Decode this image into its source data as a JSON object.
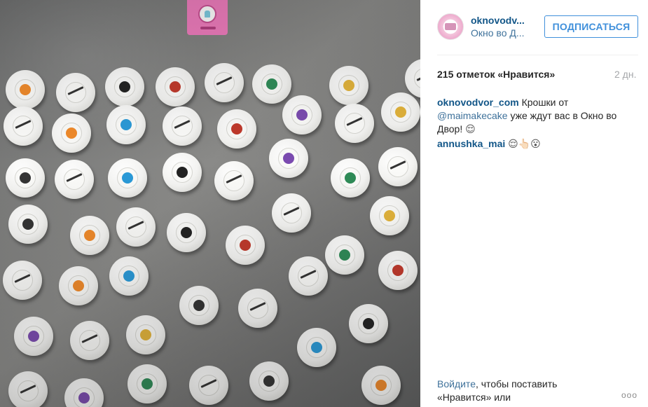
{
  "post": {
    "author_username": "oknovodv...",
    "location": "Окно во Д...",
    "follow_label": "ПОДПИСАТЬСЯ",
    "likes": "215 отметок «Нравится»",
    "time_ago": "2 дн.",
    "caption": {
      "username": "oknovodvor_com",
      "text_before": "Крошки от",
      "mention": "@maimakecake",
      "text_after": "уже ждут вас в Окно во Двор!",
      "emoji": "😌"
    },
    "comments": [
      {
        "username": "annushka_mai",
        "text": "😌👆🏻😮"
      }
    ],
    "login_prompt": {
      "link": "Войдите",
      "text": ", чтобы поставить «Нравится» или"
    },
    "more_label": "ooo"
  },
  "colors": {
    "link": "#125688",
    "mention": "#3f729b",
    "follow": "#4090db",
    "muted": "#a5a7aa"
  },
  "icons": {
    "more": "more-options-icon"
  }
}
